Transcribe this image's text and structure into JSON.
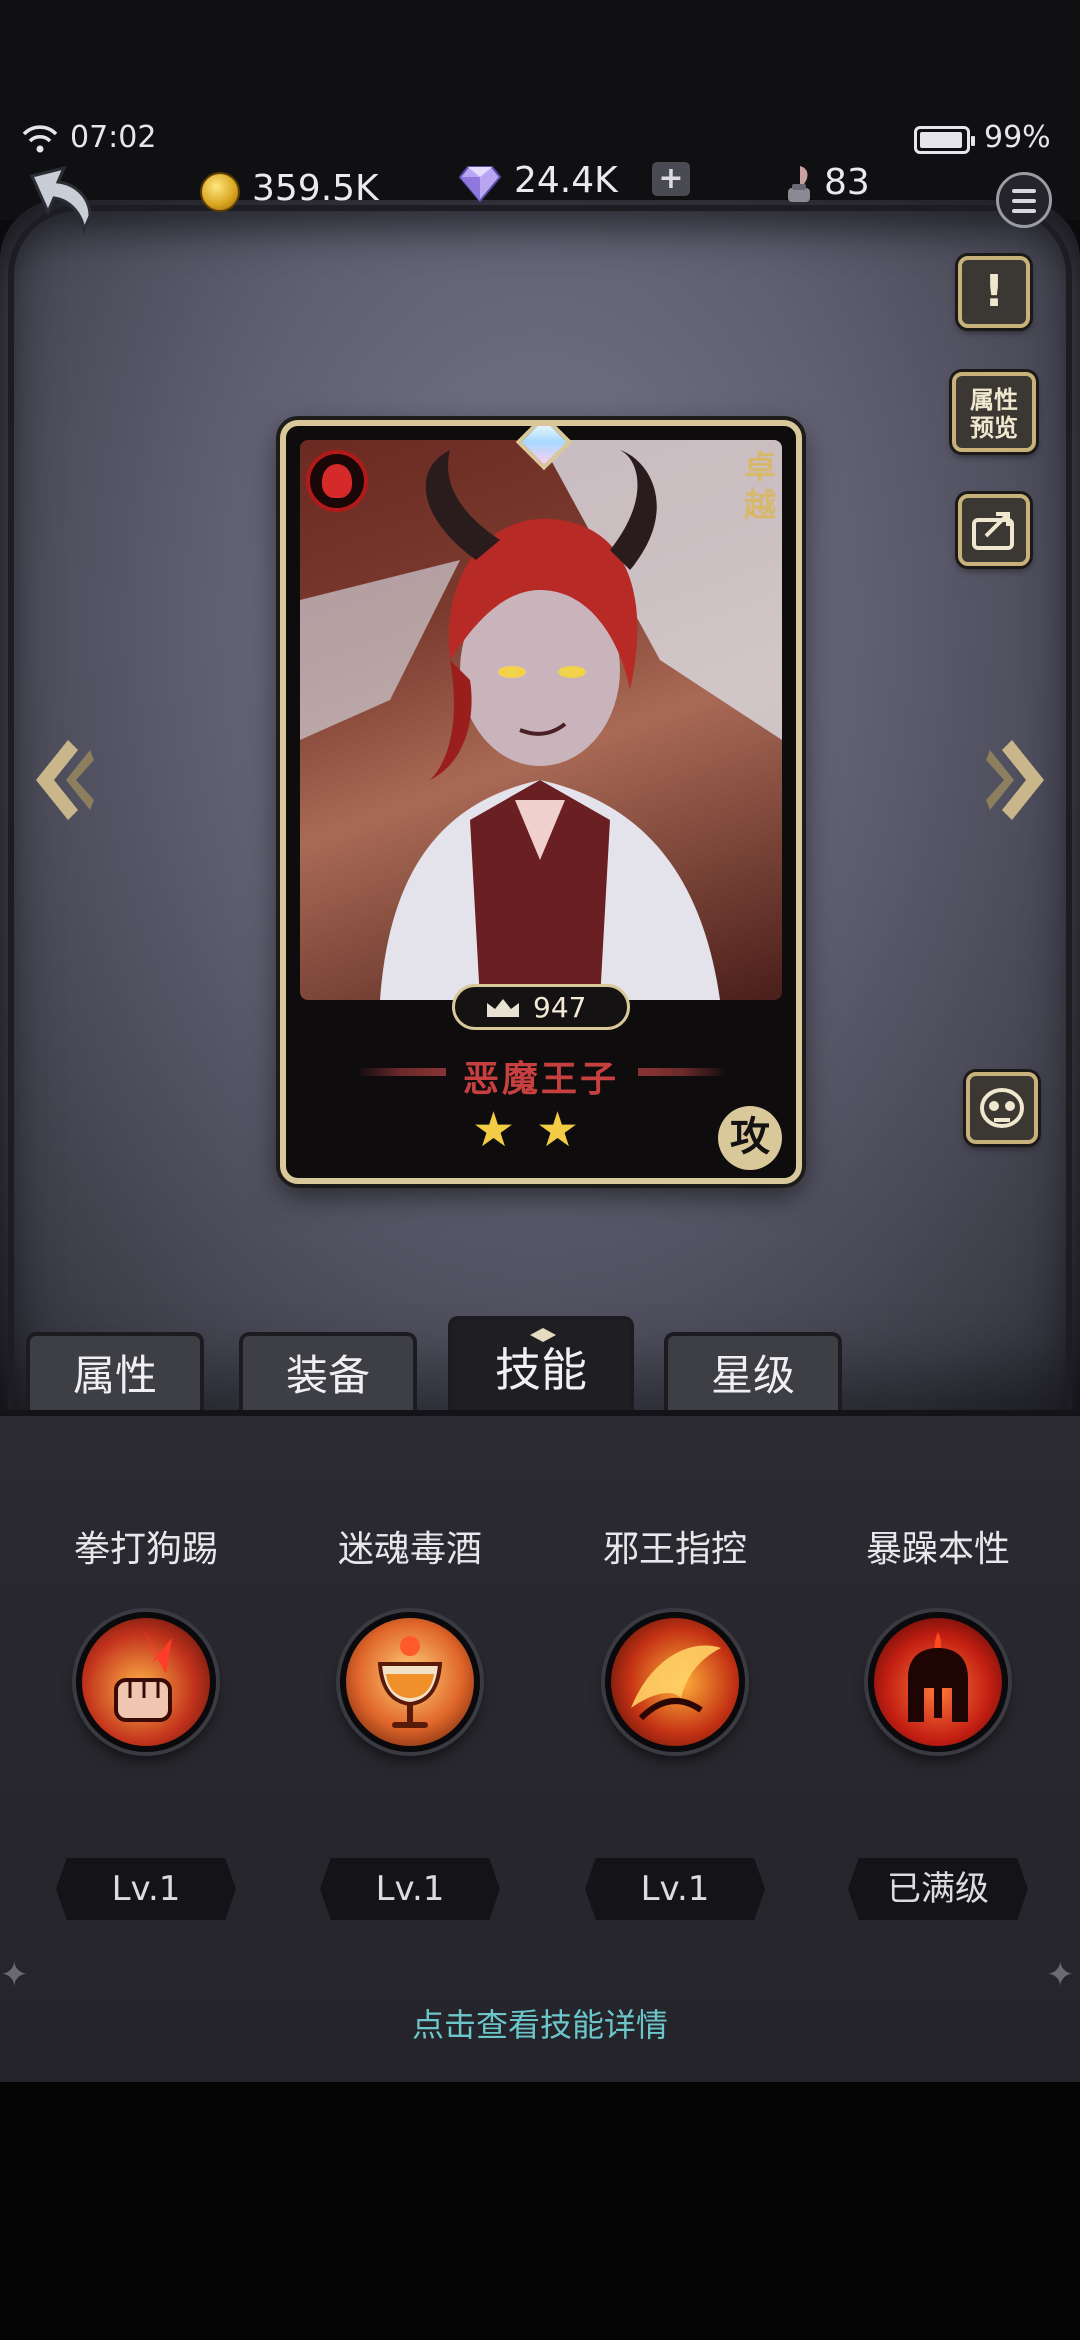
{
  "status_bar": {
    "time": "07:02",
    "battery": "99%"
  },
  "resources": {
    "gold": "359.5K",
    "gems": "24.4K",
    "gems_add": "+",
    "stamina": "83"
  },
  "side_buttons": {
    "info": "!",
    "attr_preview_line1": "属性",
    "attr_preview_line2": "预览"
  },
  "hero": {
    "rarity": "卓越",
    "power": "947",
    "name": "恶魔王子",
    "stars": 2,
    "role": "攻"
  },
  "tabs": [
    {
      "label": "属性",
      "active": false
    },
    {
      "label": "装备",
      "active": false
    },
    {
      "label": "技能",
      "active": true
    },
    {
      "label": "星级",
      "active": false
    }
  ],
  "skills": [
    {
      "name": "拳打狗踢",
      "level": "Lv.1",
      "icon": "fist-punch-icon"
    },
    {
      "name": "迷魂毒酒",
      "level": "Lv.1",
      "icon": "poison-wine-icon"
    },
    {
      "name": "邪王指控",
      "level": "Lv.1",
      "icon": "dragon-claw-icon"
    },
    {
      "name": "暴躁本性",
      "level": "已满级",
      "icon": "flaming-helmet-icon"
    }
  ],
  "hint": "点击查看技能详情",
  "colors": {
    "card_frame": "#d9c89a",
    "hero_name": "#c64040",
    "star": "#f2cc45",
    "hint": "#6bc5c9"
  }
}
